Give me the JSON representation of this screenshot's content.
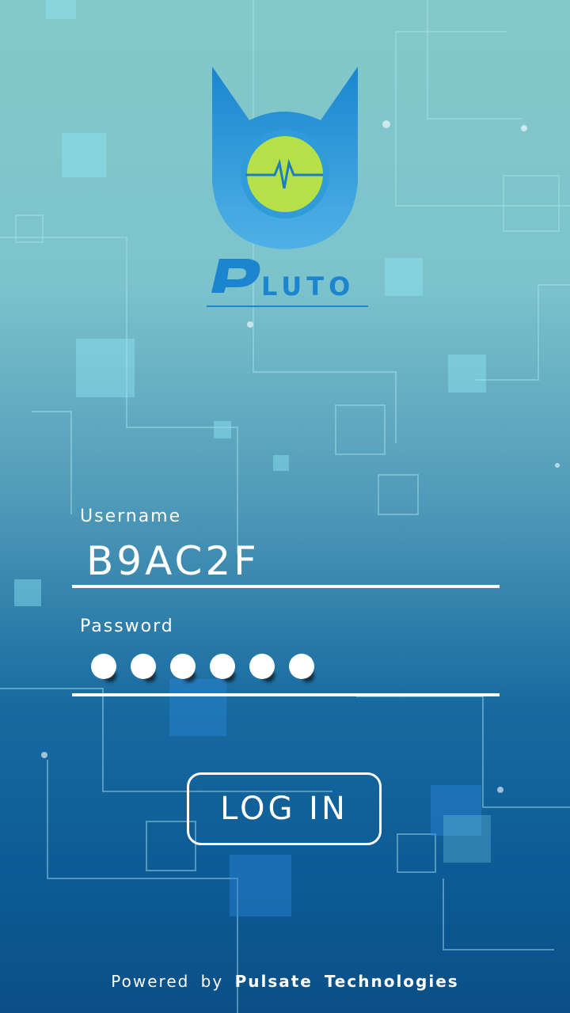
{
  "app": {
    "logo_text": "LUTO",
    "logo_initial": "P"
  },
  "form": {
    "username_label": "Username",
    "username_value": "B9AC2F",
    "password_label": "Password",
    "password_masked_count": 6
  },
  "actions": {
    "login_label": "LOG IN"
  },
  "footer": {
    "powered_text": "Powered  by",
    "company": "Pulsate  Technologies"
  },
  "colors": {
    "accent_blue": "#2f9bd8",
    "logo_green": "#b6e04a",
    "text": "#ffffff"
  }
}
